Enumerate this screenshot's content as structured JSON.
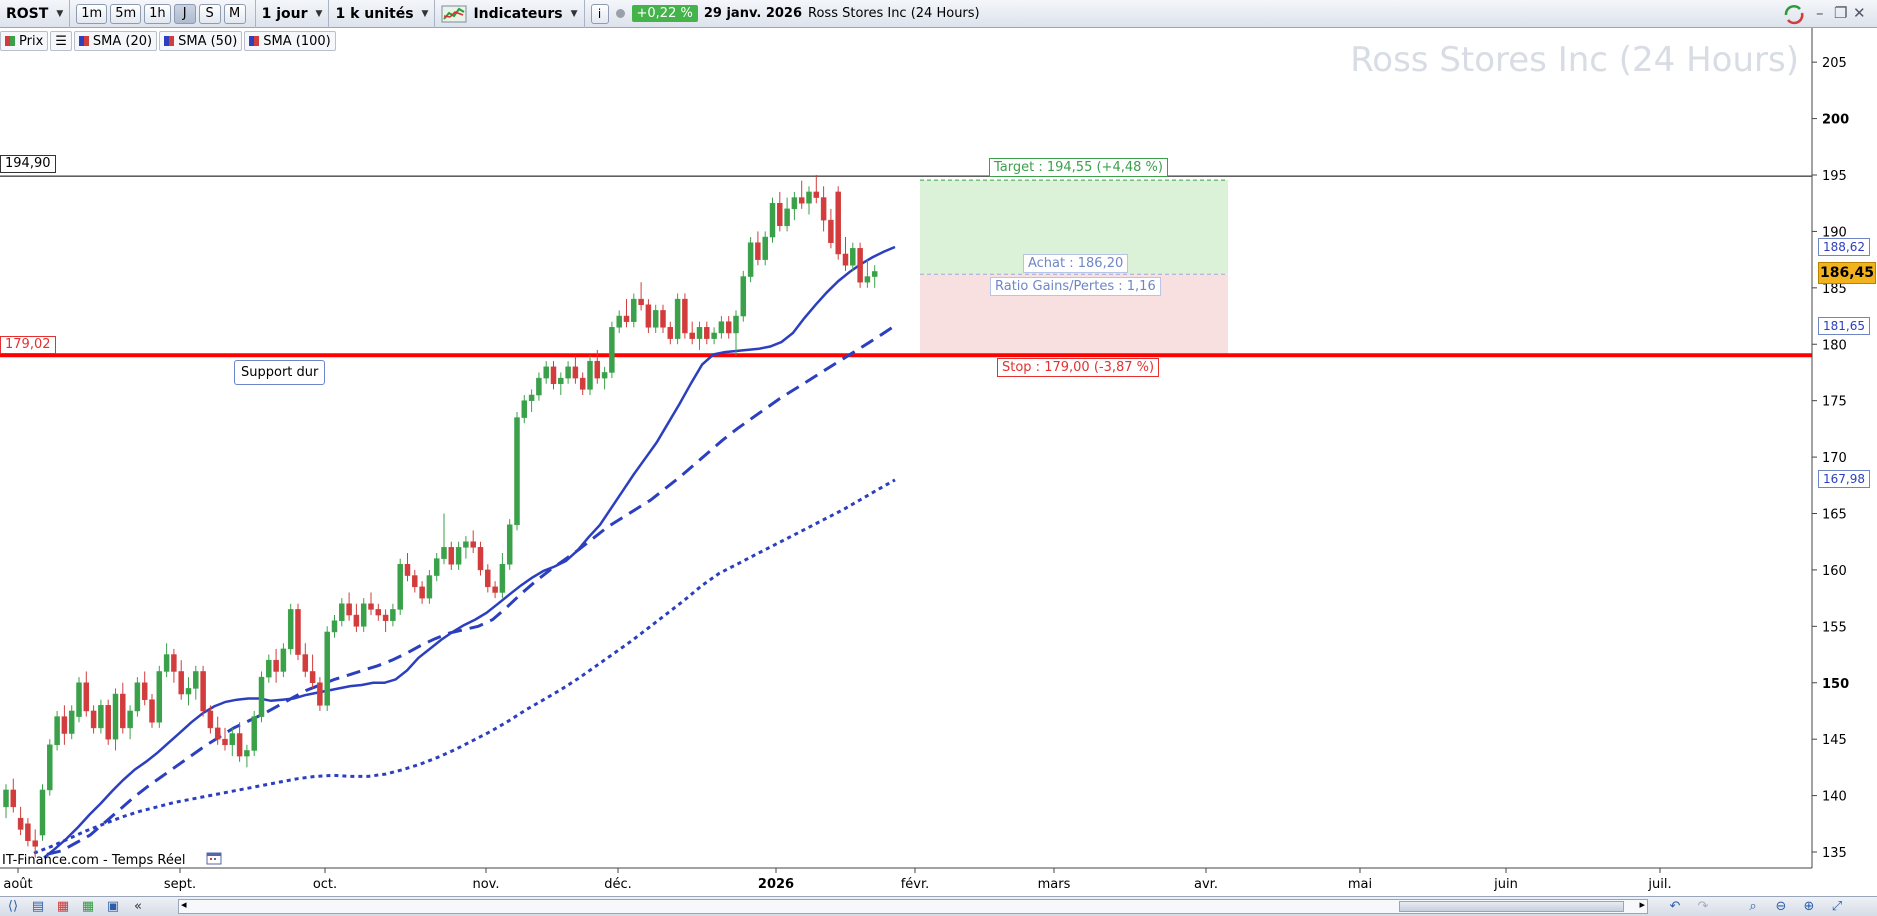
{
  "toolbar": {
    "symbol": "ROST",
    "timeframes": [
      "1m",
      "5m",
      "1h",
      "J",
      "S",
      "M"
    ],
    "period": "1 jour",
    "units": "1 k unités",
    "indicators_label": "Indicateurs",
    "performance": "+0,22 %",
    "date": "29 janv. 2026",
    "instrument": "Ross Stores Inc (24 Hours)"
  },
  "legend": {
    "items": [
      {
        "label": "Prix",
        "color": "#3aa14a"
      },
      {
        "label": "SMA (20)",
        "color": "#2b3fbf"
      },
      {
        "label": "SMA (50)",
        "color": "#2b3fbf"
      },
      {
        "label": "SMA (100)",
        "color": "#2b3fbf"
      }
    ]
  },
  "watermark": "Ross Stores Inc (24 Hours)",
  "annotations": {
    "resistance_label": "194,90",
    "support_label": "179,02",
    "support_text": "Support dur",
    "target": "Target : 194,55 (+4,48 %)",
    "entry": "Achat : 186,20",
    "ratio": "Ratio Gains/Pertes : 1,16",
    "stop": "Stop : 179,00 (-3,87 %)",
    "source": "IT-Finance.com - Temps Réel"
  },
  "right_axis": {
    "ticks": [
      "205",
      "200",
      "195",
      "190",
      "185",
      "180",
      "175",
      "170",
      "165",
      "160",
      "155",
      "150",
      "145",
      "140",
      "135"
    ],
    "last_price": "186,45",
    "sma20_value": "188,62",
    "sma50_value": "181,65",
    "sma100_value": "167,98"
  },
  "bottom_axis": {
    "months": [
      "août",
      "sept.",
      "oct.",
      "nov.",
      "déc.",
      "2026",
      "févr.",
      "mars",
      "avr.",
      "mai",
      "juin",
      "juil."
    ]
  },
  "colors": {
    "up": "#3aa14a",
    "down": "#d23c3c",
    "sma": "#2b3fbf",
    "support": "#ff0000",
    "target_zone": "#dbf2d8",
    "stop_zone": "#f9e0e0"
  },
  "chart_data": {
    "type": "candlestick",
    "ylim": [
      133,
      207
    ],
    "resistance": 194.9,
    "support": 179.02,
    "entry": 186.2,
    "target": 194.55,
    "stop": 179.0,
    "candles": [
      {
        "o": 139.0,
        "h": 141.0,
        "l": 138.0,
        "c": 140.5
      },
      {
        "o": 140.5,
        "h": 141.5,
        "l": 138.5,
        "c": 139.0
      },
      {
        "o": 138.0,
        "h": 139.0,
        "l": 136.5,
        "c": 137.0
      },
      {
        "o": 137.5,
        "h": 138.0,
        "l": 135.5,
        "c": 136.0
      },
      {
        "o": 136.0,
        "h": 137.0,
        "l": 134.5,
        "c": 135.5
      },
      {
        "o": 136.5,
        "h": 141.0,
        "l": 136.0,
        "c": 140.5
      },
      {
        "o": 140.5,
        "h": 145.0,
        "l": 140.0,
        "c": 144.5
      },
      {
        "o": 144.5,
        "h": 147.5,
        "l": 144.0,
        "c": 147.0
      },
      {
        "o": 147.0,
        "h": 148.0,
        "l": 144.5,
        "c": 145.5
      },
      {
        "o": 145.5,
        "h": 148.0,
        "l": 145.0,
        "c": 147.5
      },
      {
        "o": 147.0,
        "h": 150.5,
        "l": 146.5,
        "c": 150.0
      },
      {
        "o": 150.0,
        "h": 151.0,
        "l": 147.0,
        "c": 147.5
      },
      {
        "o": 147.5,
        "h": 148.0,
        "l": 145.5,
        "c": 146.0
      },
      {
        "o": 146.0,
        "h": 148.5,
        "l": 145.5,
        "c": 148.0
      },
      {
        "o": 148.0,
        "h": 148.5,
        "l": 144.5,
        "c": 145.0
      },
      {
        "o": 145.0,
        "h": 149.5,
        "l": 144.0,
        "c": 149.0
      },
      {
        "o": 149.0,
        "h": 150.0,
        "l": 145.5,
        "c": 146.0
      },
      {
        "o": 146.0,
        "h": 148.0,
        "l": 145.0,
        "c": 147.5
      },
      {
        "o": 147.5,
        "h": 150.5,
        "l": 147.0,
        "c": 150.0
      },
      {
        "o": 150.0,
        "h": 151.0,
        "l": 148.0,
        "c": 148.5
      },
      {
        "o": 148.5,
        "h": 149.0,
        "l": 146.0,
        "c": 146.5
      },
      {
        "o": 146.5,
        "h": 151.5,
        "l": 146.0,
        "c": 151.0
      },
      {
        "o": 151.0,
        "h": 153.5,
        "l": 150.5,
        "c": 152.5
      },
      {
        "o": 152.5,
        "h": 153.0,
        "l": 150.0,
        "c": 151.0
      },
      {
        "o": 151.0,
        "h": 152.0,
        "l": 148.5,
        "c": 149.0
      },
      {
        "o": 149.0,
        "h": 150.5,
        "l": 148.0,
        "c": 149.5
      },
      {
        "o": 149.5,
        "h": 151.5,
        "l": 148.5,
        "c": 151.0
      },
      {
        "o": 151.0,
        "h": 151.5,
        "l": 147.0,
        "c": 147.5
      },
      {
        "o": 147.5,
        "h": 148.0,
        "l": 145.5,
        "c": 146.0
      },
      {
        "o": 146.0,
        "h": 147.0,
        "l": 144.5,
        "c": 145.0
      },
      {
        "o": 145.0,
        "h": 146.0,
        "l": 144.0,
        "c": 144.5
      },
      {
        "o": 144.5,
        "h": 146.0,
        "l": 143.5,
        "c": 145.5
      },
      {
        "o": 145.5,
        "h": 146.5,
        "l": 143.0,
        "c": 143.5
      },
      {
        "o": 143.5,
        "h": 144.5,
        "l": 142.5,
        "c": 144.0
      },
      {
        "o": 144.0,
        "h": 147.5,
        "l": 143.5,
        "c": 147.0
      },
      {
        "o": 147.0,
        "h": 151.0,
        "l": 146.5,
        "c": 150.5
      },
      {
        "o": 150.5,
        "h": 152.5,
        "l": 150.0,
        "c": 152.0
      },
      {
        "o": 152.0,
        "h": 153.0,
        "l": 150.0,
        "c": 151.0
      },
      {
        "o": 151.0,
        "h": 153.5,
        "l": 150.5,
        "c": 153.0
      },
      {
        "o": 153.0,
        "h": 157.0,
        "l": 152.5,
        "c": 156.5
      },
      {
        "o": 156.5,
        "h": 157.0,
        "l": 152.0,
        "c": 152.5
      },
      {
        "o": 152.5,
        "h": 153.5,
        "l": 150.5,
        "c": 151.0
      },
      {
        "o": 151.0,
        "h": 152.5,
        "l": 149.5,
        "c": 150.0
      },
      {
        "o": 150.0,
        "h": 150.5,
        "l": 147.5,
        "c": 148.0
      },
      {
        "o": 148.0,
        "h": 155.0,
        "l": 147.5,
        "c": 154.5
      },
      {
        "o": 154.5,
        "h": 156.0,
        "l": 154.0,
        "c": 155.5
      },
      {
        "o": 155.5,
        "h": 157.5,
        "l": 155.0,
        "c": 157.0
      },
      {
        "o": 157.0,
        "h": 158.0,
        "l": 155.5,
        "c": 156.0
      },
      {
        "o": 156.0,
        "h": 157.0,
        "l": 154.5,
        "c": 155.0
      },
      {
        "o": 155.0,
        "h": 157.5,
        "l": 154.5,
        "c": 157.0
      },
      {
        "o": 157.0,
        "h": 158.0,
        "l": 156.0,
        "c": 156.5
      },
      {
        "o": 156.5,
        "h": 157.0,
        "l": 155.5,
        "c": 156.0
      },
      {
        "o": 156.0,
        "h": 156.5,
        "l": 154.5,
        "c": 155.5
      },
      {
        "o": 155.5,
        "h": 157.0,
        "l": 155.0,
        "c": 156.5
      },
      {
        "o": 156.5,
        "h": 161.0,
        "l": 156.0,
        "c": 160.5
      },
      {
        "o": 160.5,
        "h": 161.5,
        "l": 159.0,
        "c": 159.5
      },
      {
        "o": 159.5,
        "h": 160.0,
        "l": 158.0,
        "c": 158.5
      },
      {
        "o": 158.5,
        "h": 159.0,
        "l": 157.0,
        "c": 157.5
      },
      {
        "o": 157.5,
        "h": 160.0,
        "l": 157.0,
        "c": 159.5
      },
      {
        "o": 159.5,
        "h": 161.5,
        "l": 159.0,
        "c": 161.0
      },
      {
        "o": 161.0,
        "h": 165.0,
        "l": 160.5,
        "c": 162.0
      },
      {
        "o": 162.0,
        "h": 162.5,
        "l": 160.0,
        "c": 160.5
      },
      {
        "o": 160.5,
        "h": 162.5,
        "l": 160.0,
        "c": 162.0
      },
      {
        "o": 162.0,
        "h": 163.0,
        "l": 161.0,
        "c": 162.5
      },
      {
        "o": 162.5,
        "h": 163.5,
        "l": 161.5,
        "c": 162.0
      },
      {
        "o": 162.0,
        "h": 162.5,
        "l": 159.5,
        "c": 160.0
      },
      {
        "o": 160.0,
        "h": 160.5,
        "l": 158.0,
        "c": 158.5
      },
      {
        "o": 158.5,
        "h": 159.0,
        "l": 157.5,
        "c": 158.0
      },
      {
        "o": 158.0,
        "h": 161.5,
        "l": 157.5,
        "c": 160.5
      },
      {
        "o": 160.5,
        "h": 164.5,
        "l": 160.0,
        "c": 164.0
      },
      {
        "o": 164.0,
        "h": 174.0,
        "l": 163.5,
        "c": 173.5
      },
      {
        "o": 173.5,
        "h": 175.5,
        "l": 173.0,
        "c": 175.0
      },
      {
        "o": 175.0,
        "h": 176.0,
        "l": 174.0,
        "c": 175.5
      },
      {
        "o": 175.5,
        "h": 177.5,
        "l": 175.0,
        "c": 177.0
      },
      {
        "o": 177.0,
        "h": 178.5,
        "l": 176.5,
        "c": 178.0
      },
      {
        "o": 178.0,
        "h": 178.5,
        "l": 176.0,
        "c": 176.5
      },
      {
        "o": 176.5,
        "h": 177.5,
        "l": 175.5,
        "c": 177.0
      },
      {
        "o": 177.0,
        "h": 178.5,
        "l": 176.5,
        "c": 178.0
      },
      {
        "o": 178.0,
        "h": 179.0,
        "l": 176.5,
        "c": 177.0
      },
      {
        "o": 177.0,
        "h": 177.5,
        "l": 175.5,
        "c": 176.0
      },
      {
        "o": 176.0,
        "h": 179.0,
        "l": 175.5,
        "c": 178.5
      },
      {
        "o": 178.5,
        "h": 179.5,
        "l": 176.5,
        "c": 177.0
      },
      {
        "o": 177.0,
        "h": 178.0,
        "l": 176.0,
        "c": 177.5
      },
      {
        "o": 177.5,
        "h": 182.0,
        "l": 177.0,
        "c": 181.5
      },
      {
        "o": 181.5,
        "h": 183.0,
        "l": 181.0,
        "c": 182.5
      },
      {
        "o": 182.5,
        "h": 184.0,
        "l": 181.5,
        "c": 182.0
      },
      {
        "o": 182.0,
        "h": 184.5,
        "l": 181.5,
        "c": 184.0
      },
      {
        "o": 184.0,
        "h": 185.5,
        "l": 183.0,
        "c": 183.5
      },
      {
        "o": 183.5,
        "h": 184.0,
        "l": 181.0,
        "c": 181.5
      },
      {
        "o": 181.5,
        "h": 183.5,
        "l": 181.0,
        "c": 183.0
      },
      {
        "o": 183.0,
        "h": 183.5,
        "l": 181.0,
        "c": 181.5
      },
      {
        "o": 181.5,
        "h": 182.0,
        "l": 180.0,
        "c": 180.5
      },
      {
        "o": 180.5,
        "h": 184.5,
        "l": 180.0,
        "c": 184.0
      },
      {
        "o": 184.0,
        "h": 184.5,
        "l": 180.5,
        "c": 181.0
      },
      {
        "o": 181.0,
        "h": 182.0,
        "l": 180.0,
        "c": 180.5
      },
      {
        "o": 180.5,
        "h": 182.0,
        "l": 179.5,
        "c": 181.5
      },
      {
        "o": 181.5,
        "h": 182.0,
        "l": 180.0,
        "c": 180.5
      },
      {
        "o": 180.5,
        "h": 181.5,
        "l": 180.0,
        "c": 181.0
      },
      {
        "o": 181.0,
        "h": 182.5,
        "l": 180.5,
        "c": 182.0
      },
      {
        "o": 182.0,
        "h": 182.5,
        "l": 180.5,
        "c": 181.0
      },
      {
        "o": 181.0,
        "h": 183.0,
        "l": 179.0,
        "c": 182.5
      },
      {
        "o": 182.5,
        "h": 186.5,
        "l": 182.0,
        "c": 186.0
      },
      {
        "o": 186.0,
        "h": 189.5,
        "l": 185.5,
        "c": 189.0
      },
      {
        "o": 189.0,
        "h": 190.0,
        "l": 187.0,
        "c": 187.5
      },
      {
        "o": 187.5,
        "h": 190.0,
        "l": 187.0,
        "c": 189.5
      },
      {
        "o": 189.5,
        "h": 193.0,
        "l": 189.0,
        "c": 192.5
      },
      {
        "o": 192.5,
        "h": 193.5,
        "l": 190.0,
        "c": 190.5
      },
      {
        "o": 190.5,
        "h": 193.0,
        "l": 190.0,
        "c": 192.0
      },
      {
        "o": 192.0,
        "h": 193.5,
        "l": 191.0,
        "c": 193.0
      },
      {
        "o": 193.0,
        "h": 194.5,
        "l": 192.0,
        "c": 192.5
      },
      {
        "o": 192.5,
        "h": 194.0,
        "l": 191.5,
        "c": 193.5
      },
      {
        "o": 193.5,
        "h": 195.0,
        "l": 192.5,
        "c": 193.0
      },
      {
        "o": 193.0,
        "h": 194.0,
        "l": 190.0,
        "c": 191.0
      },
      {
        "o": 191.0,
        "h": 192.0,
        "l": 188.5,
        "c": 189.0
      },
      {
        "o": 193.5,
        "h": 194.0,
        "l": 187.5,
        "c": 188.0
      },
      {
        "o": 188.0,
        "h": 189.5,
        "l": 186.5,
        "c": 187.0
      },
      {
        "o": 187.0,
        "h": 189.0,
        "l": 186.5,
        "c": 188.5
      },
      {
        "o": 188.5,
        "h": 189.0,
        "l": 185.0,
        "c": 185.5
      },
      {
        "o": 185.5,
        "h": 187.5,
        "l": 185.0,
        "c": 186.0
      },
      {
        "o": 186.0,
        "h": 187.0,
        "l": 185.0,
        "c": 186.45
      }
    ],
    "sma20": [
      134.5,
      135.3,
      136.2,
      137.2,
      138.3,
      139.3,
      140.4,
      141.4,
      142.3,
      143.0,
      143.8,
      144.7,
      145.6,
      146.5,
      147.3,
      147.9,
      148.3,
      148.5,
      148.6,
      148.6,
      148.4,
      148.5,
      148.6,
      148.9,
      149.1,
      149.3,
      149.5,
      149.7,
      149.8,
      150.0,
      150.0,
      150.3,
      151.1,
      152.2,
      153.0,
      153.8,
      154.5,
      155.1,
      155.6,
      156.2,
      157.0,
      157.8,
      158.6,
      159.3,
      159.9,
      160.3,
      160.8,
      161.7,
      162.9,
      164.0,
      165.5,
      167.0,
      168.5,
      169.9,
      171.3,
      173.0,
      174.7,
      176.5,
      178.2,
      179.1,
      179.3,
      179.4,
      179.5,
      179.6,
      179.8,
      180.2,
      181.0,
      182.3,
      183.5,
      184.6,
      185.6,
      186.4,
      187.1,
      187.7,
      188.2,
      188.62
    ],
    "sma20_x0": 44,
    "sma50": [
      134.8,
      135.1,
      135.8,
      136.5,
      137.6,
      138.7,
      139.8,
      140.8,
      141.7,
      142.6,
      143.5,
      144.4,
      145.2,
      146.0,
      146.6,
      147.2,
      147.9,
      148.6,
      149.3,
      149.8,
      150.3,
      150.7,
      151.1,
      151.5,
      152.0,
      152.6,
      153.3,
      153.9,
      154.4,
      154.7,
      155.0,
      155.6,
      156.7,
      157.9,
      159.0,
      160.0,
      160.9,
      161.8,
      162.8,
      163.8,
      164.6,
      165.4,
      166.2,
      167.2,
      168.2,
      169.3,
      170.4,
      171.5,
      172.5,
      173.4,
      174.3,
      175.2,
      176.0,
      176.8,
      177.6,
      178.4,
      179.2,
      180.0,
      180.8,
      181.65
    ],
    "sma50_x0": 47,
    "sma100": [
      134.9,
      135.5,
      136.2,
      136.9,
      137.5,
      138.1,
      138.6,
      139.0,
      139.4,
      139.7,
      140.0,
      140.3,
      140.6,
      140.9,
      141.2,
      141.5,
      141.7,
      141.8,
      141.7,
      141.7,
      141.9,
      142.3,
      142.8,
      143.4,
      144.1,
      144.9,
      145.7,
      146.6,
      147.6,
      148.5,
      149.4,
      150.4,
      151.5,
      152.6,
      153.7,
      154.9,
      156.1,
      157.3,
      158.6,
      159.7,
      160.5,
      161.3,
      162.1,
      162.9,
      163.7,
      164.5,
      165.3,
      166.2,
      167.1,
      167.98
    ],
    "sma100_x0": 34,
    "sma_x1": 895
  }
}
